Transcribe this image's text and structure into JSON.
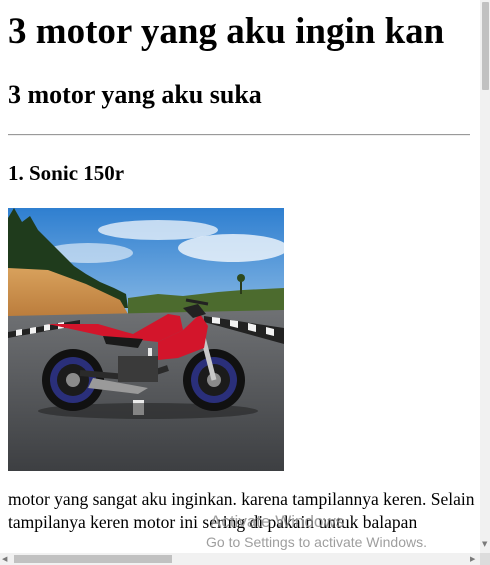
{
  "page": {
    "heading1": "3 motor yang aku ingin kan",
    "heading2": "3 motor yang aku suka",
    "item1": {
      "title": "1. Sonic 150r",
      "description": "motor yang sangat aku inginkan. karena tampilannya keren. Selain tampilanya keren motor ini sering di pakain untuk balapan"
    }
  },
  "watermark": {
    "line1": "Activate Windows",
    "line2": "Go to Settings to activate Windows."
  },
  "colors": {
    "background": "#ffffff",
    "text": "#000000",
    "scrollbar_track": "#f1f1f1",
    "scrollbar_thumb": "#c1c1c1",
    "motorcycle_red": "#d3152b"
  }
}
